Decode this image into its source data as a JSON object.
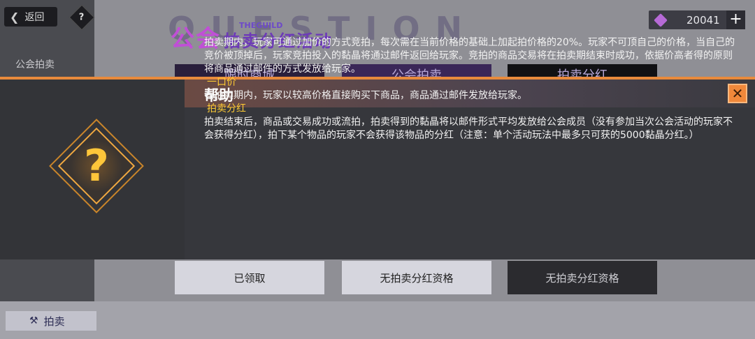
{
  "header": {
    "back_label": "返回",
    "help_icon_label": "?",
    "banner_ghost": "QUESTION",
    "banner_title": "公会",
    "banner_guild": "THEGUILD",
    "banner_subtitle": "拍卖分红活动",
    "currency_amount": "20041",
    "plus_label": "+"
  },
  "sidebar": {
    "active_item": "公会拍卖"
  },
  "cards": [
    {
      "label": "限时商城"
    },
    {
      "label": "公会拍卖"
    },
    {
      "label": "拍卖分红"
    }
  ],
  "bottom_buttons": [
    {
      "label": "已领取"
    },
    {
      "label": "无拍卖分红资格"
    },
    {
      "label": "无拍卖分红资格"
    }
  ],
  "bottom_tab": {
    "label": "拍卖"
  },
  "dialog": {
    "title": "帮助",
    "close_label": "✕",
    "paragraph1": "拍卖期内，玩家可通过加价的方式竞拍，每次需在当前价格的基础上加起拍价格的20%。玩家不可顶自己的价格，当自己的竞价被顶掉后，玩家竞拍投入的黏晶将通过邮件返回给玩家。竞拍的商品交易将在拍卖期结束时成功，依据价高者得的原则将商品通过邮件的方式发放给玩家。",
    "heading2": "一口价",
    "paragraph2": "在拍卖期内，玩家以较高价格直接购买下商品，商品通过邮件发放给玩家。",
    "heading3": "拍卖分红",
    "paragraph3": "拍卖结束后，商品或交易成功或流拍，拍卖得到的黏晶将以邮件形式平均发放给公会成员（没有参加当次公会活动的玩家不会获得分红），拍下某个物品的玩家不会获得该物品的分红（注意：单个活动玩法中最多只可获的5000黏晶分红。）"
  },
  "colors": {
    "accent_orange": "#e88a3c",
    "heading_yellow": "#ffcc33",
    "dialog_bg": "#3b3c41"
  }
}
